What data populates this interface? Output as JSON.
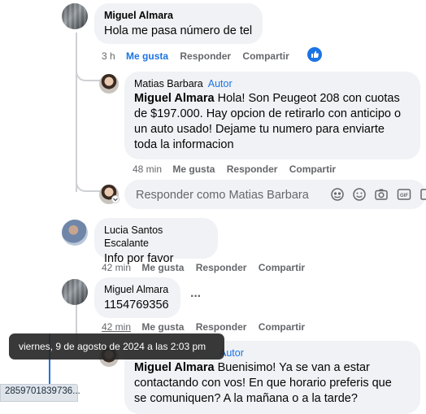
{
  "comments": [
    {
      "author": "Miguel Almara",
      "text": "Hola me pasa número de tel",
      "time": "3 h",
      "like": "Me gusta",
      "reply": "Responder",
      "share": "Compartir"
    },
    {
      "author": "Matias Barbara",
      "author_badge": "Autor",
      "mention": "Miguel Almara",
      "text_lines": [
        " Hola! Son Peugeot 208 con cuotas",
        "de $197.000. Hay opcion de retirarlo con anticipo o",
        "un auto usado! Dejame tu numero para enviarte",
        "toda la informacion"
      ],
      "time": "48 min",
      "like": "Me gusta",
      "reply": "Responder",
      "share": "Compartir"
    },
    {
      "author": "Lucia Santos Escalante",
      "text": "Info por favor",
      "time": "42 min",
      "like": "Me gusta",
      "reply": "Responder",
      "share": "Compartir"
    },
    {
      "author": "Miguel Almara",
      "text": "1154769356",
      "time": "42 min",
      "like": "Me gusta",
      "reply": "Responder",
      "share": "Compartir"
    },
    {
      "author_badge": "Autor",
      "mention": "Miguel Almara",
      "text_lines": [
        " Buenisimo! Ya se van a estar",
        "contactando con vos! En que horario preferis que",
        "se comuniquen? A la mañana o a la tarde?"
      ]
    }
  ],
  "reply_box": {
    "placeholder": "Responder como Matias Barbara"
  },
  "tooltip": "viernes, 9 de agosto de 2024 a las 2:03 pm",
  "status_url": "2859701839736...",
  "more_options": "···",
  "colors": {
    "link_blue": "#1b74e4",
    "bubble_bg": "#f0f2f5",
    "meta_gray": "#65676b"
  }
}
